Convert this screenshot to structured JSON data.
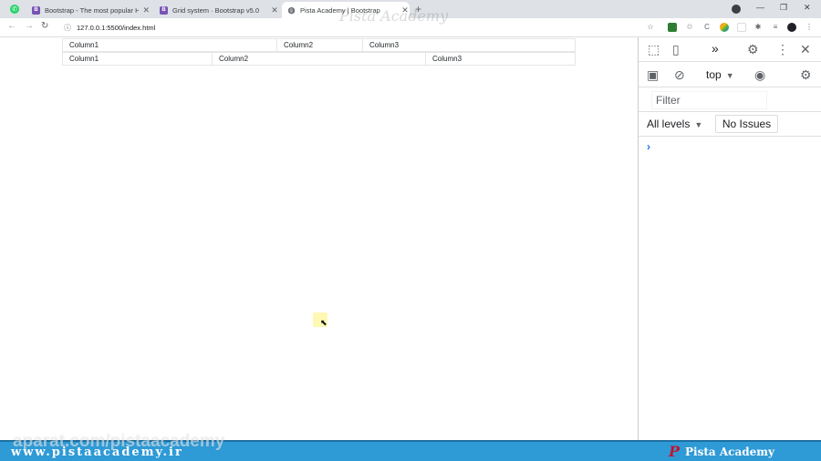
{
  "browser": {
    "tabs": [
      {
        "title": "Bootstrap - The most popular HT",
        "favicon_color": "#7952b3",
        "favicon": "B"
      },
      {
        "title": "Grid system · Bootstrap v5.0",
        "favicon_color": "#7952b3",
        "favicon": "B"
      },
      {
        "title": "Pista Academy | Bootstrap",
        "favicon_color": "#5f6368",
        "favicon": "globe-icon"
      }
    ],
    "tab_close": "✕",
    "new_tab": "+",
    "url": "127.0.0.1:5500/index.html"
  },
  "watermark": {
    "top": "Pista Academy",
    "bottom": "aparat.com/pistaacademy"
  },
  "page": {
    "row1": [
      "Column1",
      "Column2",
      "Column3"
    ],
    "row2": [
      "Column1",
      "Column2",
      "Column3"
    ]
  },
  "devtools": {
    "context": "top",
    "filter_placeholder": "Filter",
    "levels": "All levels",
    "issues": "No Issues",
    "prompt": "›"
  },
  "banner": {
    "site": "www.pistaacademy.ir",
    "brand": "Pista Academy",
    "brand_logo": "P",
    "color": "#2e9ad6"
  }
}
